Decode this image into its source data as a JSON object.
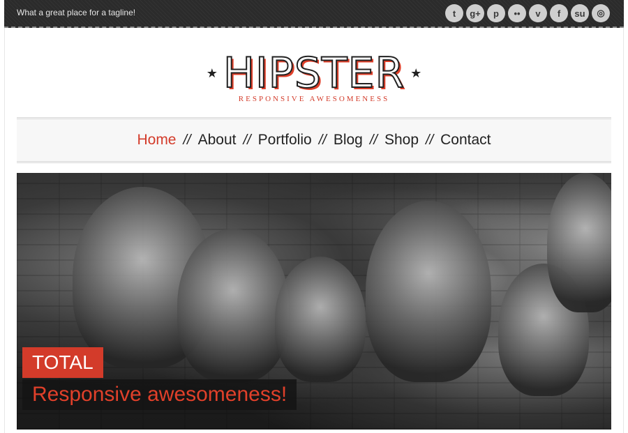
{
  "topbar": {
    "tagline": "What a great place for a tagline!",
    "social": [
      {
        "icon": "twitter-icon",
        "glyph": "t"
      },
      {
        "icon": "google-plus-icon",
        "glyph": "g+"
      },
      {
        "icon": "pinterest-icon",
        "glyph": "p"
      },
      {
        "icon": "flickr-icon",
        "glyph": "••"
      },
      {
        "icon": "vimeo-icon",
        "glyph": "v"
      },
      {
        "icon": "facebook-icon",
        "glyph": "f"
      },
      {
        "icon": "stumbleupon-icon",
        "glyph": "su"
      },
      {
        "icon": "dribbble-icon",
        "glyph": "◎"
      }
    ]
  },
  "logo": {
    "title": "HIPSTER",
    "subtitle": "RESPONSIVE AWESOMENESS"
  },
  "nav": {
    "items": [
      {
        "label": "Home",
        "active": true
      },
      {
        "label": "About"
      },
      {
        "label": "Portfolio"
      },
      {
        "label": "Blog"
      },
      {
        "label": "Shop"
      },
      {
        "label": "Contact"
      }
    ],
    "separator": "//"
  },
  "hero": {
    "caption_title": "TOTAL",
    "caption_subtitle": "Responsive awesomeness!"
  },
  "colors": {
    "accent": "#d33b2a",
    "topbar": "#2b2b2b"
  }
}
